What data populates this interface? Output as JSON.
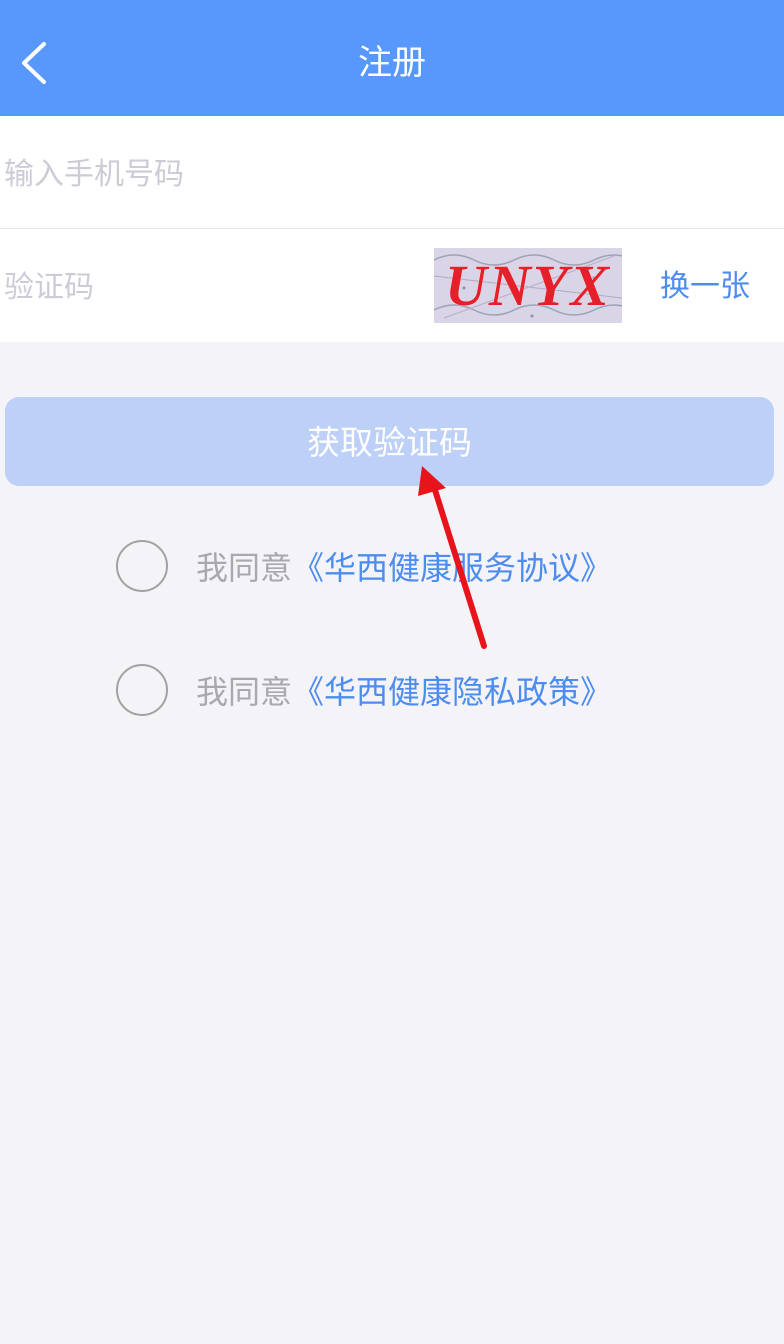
{
  "header": {
    "title": "注册",
    "back_icon": "chevron-left-icon"
  },
  "form": {
    "phone_placeholder": "输入手机号码",
    "captcha_placeholder": "验证码",
    "captcha_image_text": "UNYX",
    "refresh_label": "换一张"
  },
  "actions": {
    "get_code_label": "获取验证码"
  },
  "agreements": [
    {
      "prefix": "我同意",
      "link": "《华西健康服务协议》"
    },
    {
      "prefix": "我同意",
      "link": "《华西健康隐私政策》"
    }
  ],
  "colors": {
    "header_bg": "#5897fb",
    "link": "#4d8df0",
    "button_disabled_bg": "#bdd0f7",
    "annotation_arrow": "#e8141c"
  }
}
